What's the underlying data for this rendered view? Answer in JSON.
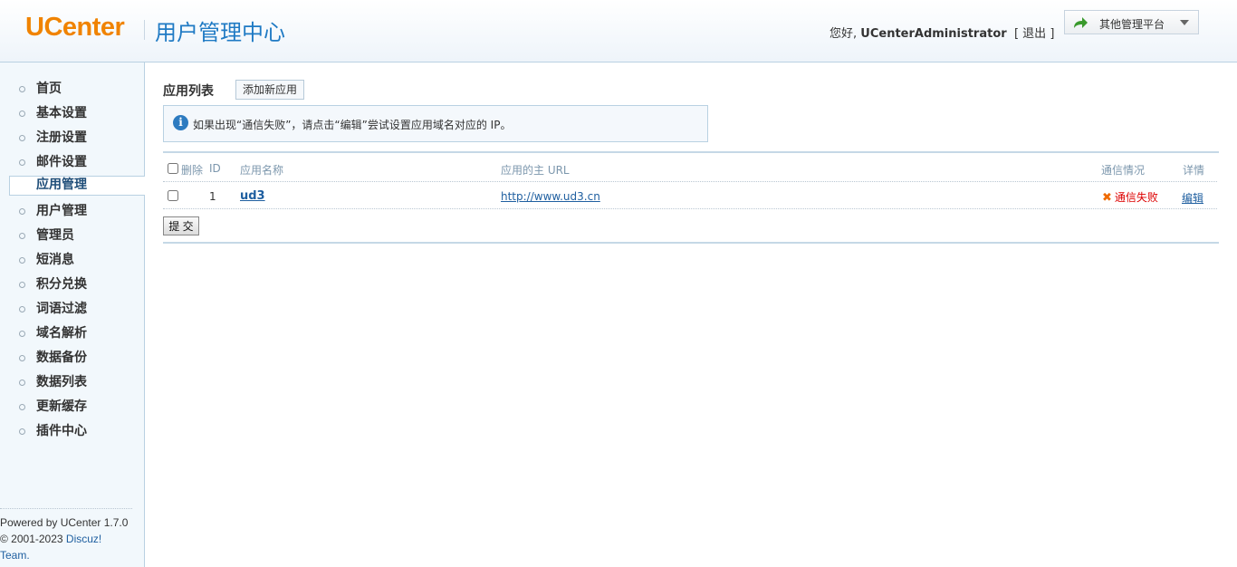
{
  "header": {
    "logo_text": "UCenter",
    "title": "用户管理中心",
    "greeting_prefix": "您好,",
    "username": "UCenterAdministrator",
    "logout_open": "[",
    "logout_label": "退出",
    "logout_close": "]",
    "platform_label": "其他管理平台"
  },
  "sidebar": {
    "items": [
      {
        "label": "首页",
        "active": false
      },
      {
        "label": "基本设置",
        "active": false
      },
      {
        "label": "注册设置",
        "active": false
      },
      {
        "label": "邮件设置",
        "active": false
      },
      {
        "label": "应用管理",
        "active": true
      },
      {
        "label": "用户管理",
        "active": false
      },
      {
        "label": "管理员",
        "active": false
      },
      {
        "label": "短消息",
        "active": false
      },
      {
        "label": "积分兑换",
        "active": false
      },
      {
        "label": "词语过滤",
        "active": false
      },
      {
        "label": "域名解析",
        "active": false
      },
      {
        "label": "数据备份",
        "active": false
      },
      {
        "label": "数据列表",
        "active": false
      },
      {
        "label": "更新缓存",
        "active": false
      },
      {
        "label": "插件中心",
        "active": false
      }
    ],
    "footer_powered": "Powered by UCenter 1.7.0",
    "footer_copyright": "© 2001-2023",
    "footer_link": "Discuz!",
    "footer_team": "Team."
  },
  "main": {
    "section_title": "应用列表",
    "add_button": "添加新应用",
    "notice": "如果出现“通信失败”，请点击“编辑”尝试设置应用域名对应的 IP。",
    "columns": {
      "delete": "删除",
      "id": "ID",
      "name": "应用名称",
      "url": "应用的主 URL",
      "status": "通信情况",
      "detail": "详情"
    },
    "rows": [
      {
        "id": "1",
        "name": "ud3",
        "url": "http://www.ud3.cn",
        "status": "通信失败",
        "detail": "编辑"
      }
    ],
    "submit_label": "提 交"
  },
  "colors": {
    "brand_orange": "#f08300",
    "title_blue": "#1f7ac4",
    "link_blue": "#1f5fa0",
    "fail_red": "#dd0000"
  }
}
